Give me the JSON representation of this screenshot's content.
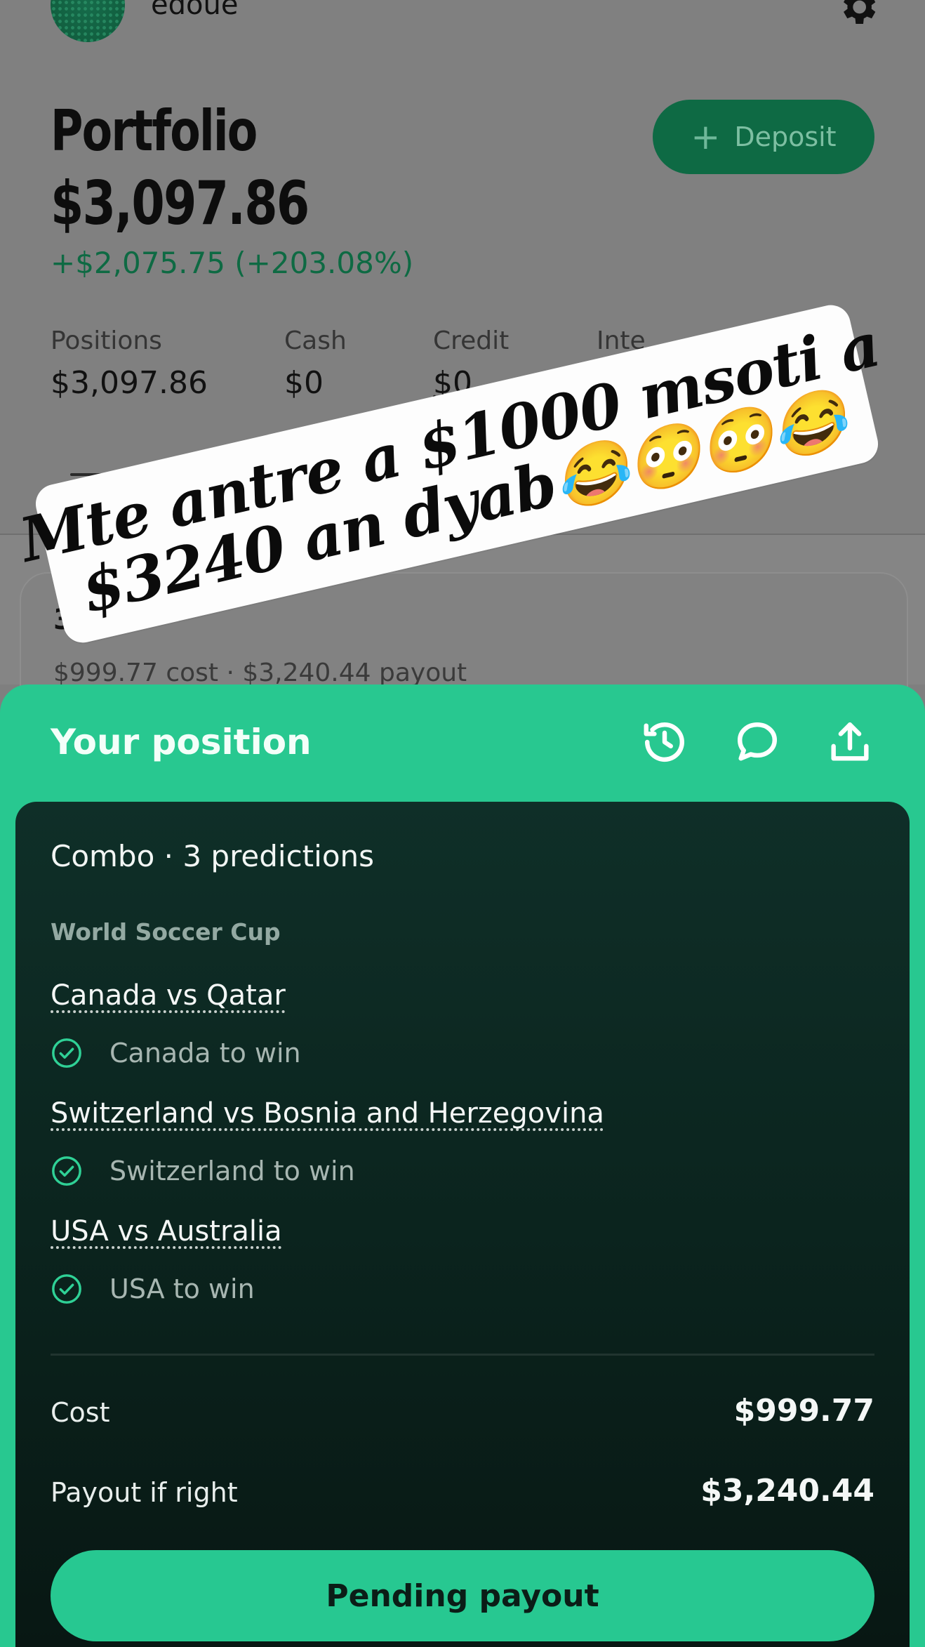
{
  "header": {
    "username": "edoue"
  },
  "portfolio": {
    "title": "Portfolio",
    "total": "$3,097.86",
    "gain": "+$2,075.75 (+203.08%)",
    "deposit_label": "Deposit",
    "stats": [
      {
        "label": "Positions",
        "value": "$3,097.86"
      },
      {
        "label": "Cash",
        "value": "$0"
      },
      {
        "label": "Credit",
        "value": "$0"
      },
      {
        "label": "Inte",
        "value": ""
      }
    ],
    "chip_fragment": "Q"
  },
  "background_card": {
    "title_fragment": "3 le",
    "subtitle": "$999.77 cost · $3,240.44 payout"
  },
  "sticker": {
    "line1": "Mte antre a $1000 msoti a",
    "line2": "$3240 an dyab😂😳😳😂"
  },
  "position_sheet": {
    "title": "Your position",
    "combo": "Combo · 3 predictions",
    "league": "World Soccer Cup",
    "legs": [
      {
        "match": "Canada vs Qatar",
        "pick": "Canada to win"
      },
      {
        "match": "Switzerland vs Bosnia and Herzegovina",
        "pick": "Switzerland to win"
      },
      {
        "match": "USA vs Australia",
        "pick": "USA to win"
      }
    ],
    "cost_label": "Cost",
    "cost_value": "$999.77",
    "payout_label": "Payout if right",
    "payout_value": "$3,240.44",
    "action_label": "Pending payout"
  },
  "colors": {
    "accent": "#28c890",
    "brand_dark": "#0e6a44",
    "panel": "#0b241e"
  },
  "icons": [
    "gear-icon",
    "plus-icon",
    "filter-icon",
    "history-icon",
    "comment-icon",
    "share-icon",
    "check-circle-icon"
  ]
}
